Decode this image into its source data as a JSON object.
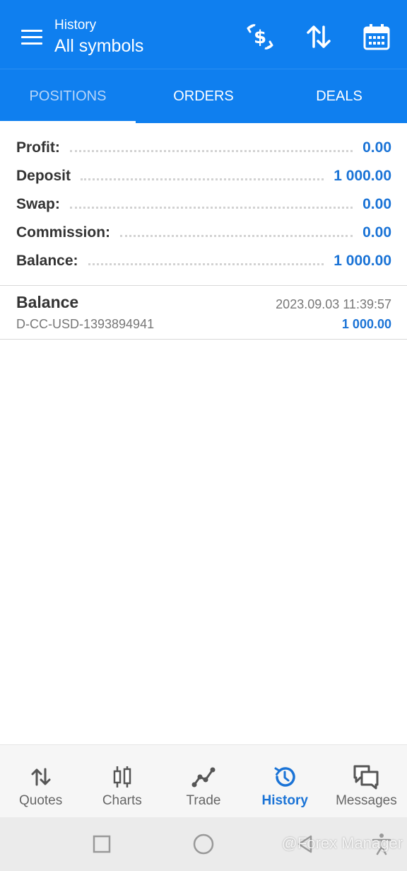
{
  "header": {
    "subtitle": "History",
    "title": "All symbols",
    "icons": [
      "menu-icon",
      "currency-exchange-icon",
      "sort-icon",
      "calendar-icon"
    ]
  },
  "tabs": [
    {
      "label": "POSITIONS",
      "active": true
    },
    {
      "label": "ORDERS",
      "active": false
    },
    {
      "label": "DEALS",
      "active": false
    }
  ],
  "summary": [
    {
      "label": "Profit:",
      "value": "0.00"
    },
    {
      "label": "Deposit",
      "value": "1 000.00"
    },
    {
      "label": "Swap:",
      "value": "0.00"
    },
    {
      "label": "Commission:",
      "value": "0.00"
    },
    {
      "label": "Balance:",
      "value": "1 000.00"
    }
  ],
  "deals": [
    {
      "name": "Balance",
      "comment": "D-CC-USD-1393894941",
      "time": "2023.09.03 11:39:57",
      "amount": "1 000.00"
    }
  ],
  "bottom_nav": [
    {
      "label": "Quotes",
      "icon": "quotes-icon",
      "active": false
    },
    {
      "label": "Charts",
      "icon": "charts-icon",
      "active": false
    },
    {
      "label": "Trade",
      "icon": "trade-icon",
      "active": false
    },
    {
      "label": "History",
      "icon": "history-icon",
      "active": true
    },
    {
      "label": "Messages",
      "icon": "messages-icon",
      "active": false
    }
  ],
  "system_nav": {
    "icons": [
      "recents-icon",
      "home-icon",
      "back-icon",
      "accessibility-icon"
    ]
  },
  "watermark": "@Forex Manager",
  "colors": {
    "primary": "#0f7fef",
    "value_blue": "#1a73d6",
    "inactive_tab": "#b8d6f9"
  }
}
